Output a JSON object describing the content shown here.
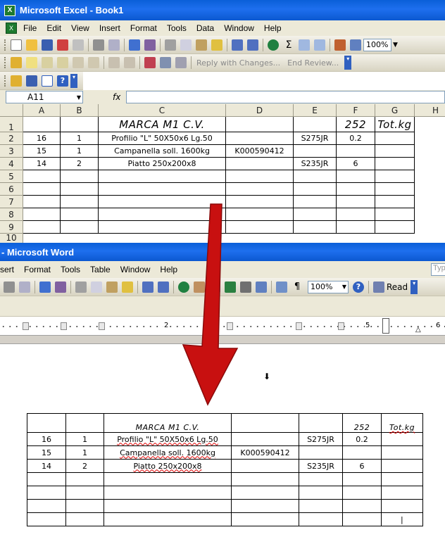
{
  "excel": {
    "title": "Microsoft Excel - Book1",
    "menu": [
      "File",
      "Edit",
      "View",
      "Insert",
      "Format",
      "Tools",
      "Data",
      "Window",
      "Help"
    ],
    "zoom": "100%",
    "review": {
      "reply": "Reply with Changes...",
      "end": "End Review..."
    },
    "name_box": "A11",
    "fx": "fx",
    "columns": [
      "A",
      "B",
      "C",
      "D",
      "E",
      "F",
      "G",
      "H"
    ],
    "rows": [
      "1",
      "2",
      "3",
      "4",
      "5",
      "6",
      "7",
      "8",
      "9",
      "10"
    ],
    "cells": [
      [
        "",
        "",
        "MARCA M1 C.V.",
        "",
        "",
        "252",
        "Tot.kg"
      ],
      [
        "16",
        "1",
        "Profilio \"L\" 50X50x6 Lg.50",
        "",
        "S275JR",
        "0.2",
        ""
      ],
      [
        "15",
        "1",
        "Campanella soll. 1600kg",
        "K000590412",
        "",
        "",
        ""
      ],
      [
        "14",
        "2",
        "Piatto 250x200x8",
        "",
        "S235JR",
        "6",
        ""
      ]
    ]
  },
  "word": {
    "title": "- Microsoft Word",
    "menu": [
      "sert",
      "Format",
      "Tools",
      "Table",
      "Window",
      "Help"
    ],
    "help_box": "Typ",
    "zoom": "100%",
    "read": "Read",
    "ruler_nums": [
      "2",
      "5",
      "6"
    ],
    "table": [
      [
        "",
        "",
        "MARCA M1 C.V.",
        "",
        "",
        "252",
        "Tot.kg"
      ],
      [
        "16",
        "1",
        "Profilio \"L\" 50X50x6 Lg.50",
        "",
        "S275JR",
        "0.2",
        ""
      ],
      [
        "15",
        "1",
        "Campanella soll. 1600kg",
        "K000590412",
        "",
        "",
        ""
      ],
      [
        "14",
        "2",
        "Piatto 250x200x8",
        "",
        "S235JR",
        "6",
        ""
      ],
      [
        "",
        "",
        "",
        "",
        "",
        "",
        ""
      ],
      [
        "",
        "",
        "",
        "",
        "",
        "",
        ""
      ],
      [
        "",
        "",
        "",
        "",
        "",
        "",
        ""
      ],
      [
        "",
        "",
        "",
        "",
        "",
        "",
        ""
      ]
    ]
  },
  "arrow_color": "#c81010",
  "brand_blue": "#0a5fd8"
}
